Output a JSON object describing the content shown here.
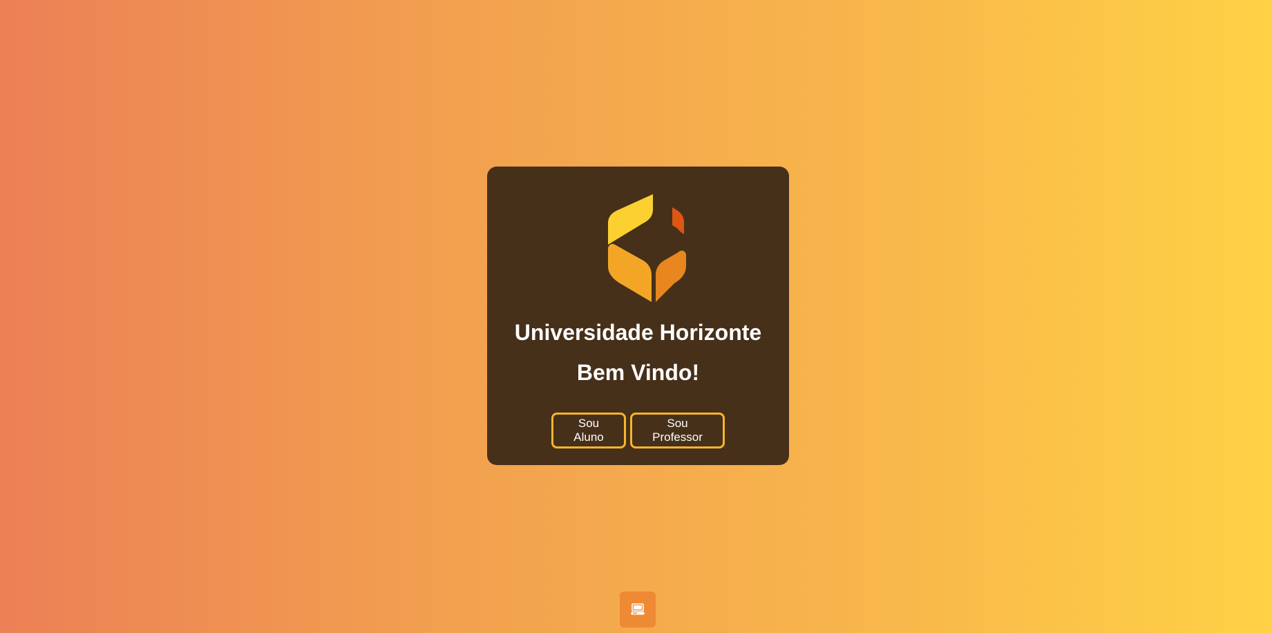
{
  "card": {
    "logo_icon": "wheat-leaves-logo-icon",
    "title": "Universidade Horizonte",
    "subtitle": "Bem Vindo!"
  },
  "buttons": {
    "aluno_label": "Sou Aluno",
    "professor_label": "Sou Professor"
  },
  "floating_button": {
    "icon": "laptop-icon"
  },
  "colors": {
    "card_background": "#46301a",
    "button_border": "#f7b52d",
    "gradient_start": "#ec8056",
    "gradient_end": "#ffd145",
    "floating_button": "#ee8a34",
    "logo_yellow": "#fdd032",
    "logo_red_orange": "#dd5612",
    "logo_amber": "#f3a626",
    "logo_orange": "#e8861f"
  }
}
